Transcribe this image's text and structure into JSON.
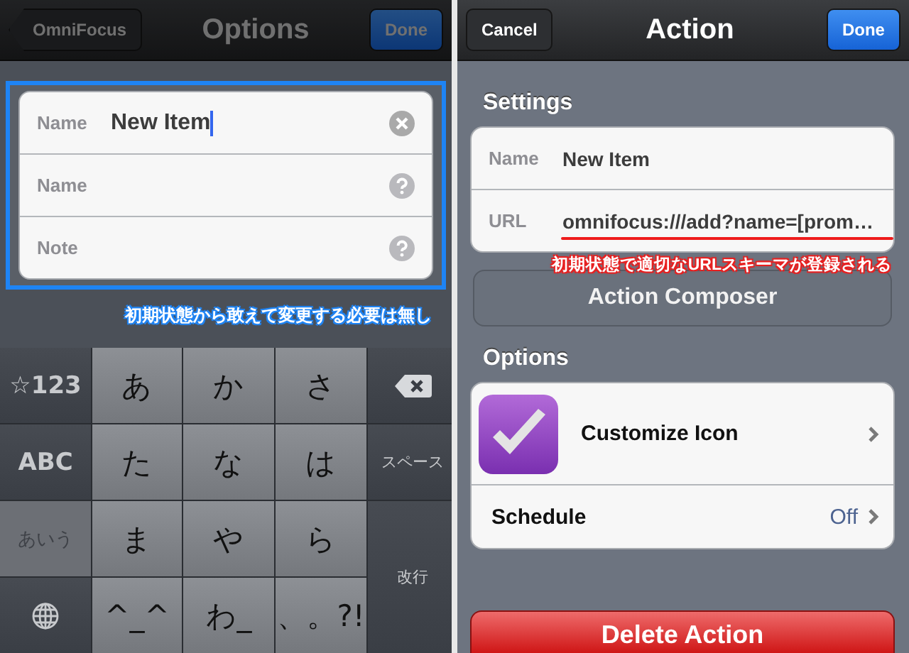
{
  "left_screen": {
    "dimmed": true,
    "nav": {
      "back_button": "OmniFocus",
      "title": "Options",
      "done_button": "Done"
    },
    "form_rows": [
      {
        "kind": "filled",
        "label": "Name",
        "value": "New Item",
        "focused": true
      },
      {
        "kind": "empty",
        "label": "Name",
        "focused": false
      },
      {
        "kind": "empty",
        "label": "Note",
        "focused": false
      }
    ],
    "annotation": "初期状態から敢えて変更する必要は無し",
    "keyboard": [
      {
        "kind": "func",
        "label": "☆123"
      },
      {
        "kind": "char",
        "label": "あ"
      },
      {
        "kind": "char",
        "label": "か"
      },
      {
        "kind": "char",
        "label": "さ"
      },
      {
        "kind": "delete"
      },
      {
        "kind": "func",
        "label": "ABC"
      },
      {
        "kind": "char",
        "label": "た"
      },
      {
        "kind": "char",
        "label": "な"
      },
      {
        "kind": "char",
        "label": "は"
      },
      {
        "kind": "small",
        "label": "スペース"
      },
      {
        "kind": "soft",
        "label": "あいう"
      },
      {
        "kind": "char",
        "label": "ま"
      },
      {
        "kind": "char",
        "label": "や"
      },
      {
        "kind": "char",
        "label": "ら"
      },
      {
        "kind": "return",
        "label": "改行"
      },
      {
        "kind": "globe"
      },
      {
        "kind": "char",
        "label": "^_^"
      },
      {
        "kind": "char",
        "label": "わ_"
      },
      {
        "kind": "char",
        "label": "、。?!"
      }
    ]
  },
  "right_screen": {
    "nav": {
      "cancel_button": "Cancel",
      "title": "Action",
      "done_button": "Done"
    },
    "settings_header": "Settings",
    "settings_rows": [
      {
        "label": "Name",
        "value": "New Item",
        "underlined": false
      },
      {
        "label": "URL",
        "value": "omnifocus:///add?name=[prom…",
        "underlined": true
      }
    ],
    "annotation": "初期状態で適切なURLスキーマが登録される",
    "composer_button": "Action Composer",
    "options_header": "Options",
    "options_rows": [
      {
        "kind": "icon",
        "label": "Customize Icon"
      },
      {
        "kind": "value",
        "label": "Schedule",
        "value": "Off"
      }
    ],
    "delete_button": "Delete Action"
  }
}
